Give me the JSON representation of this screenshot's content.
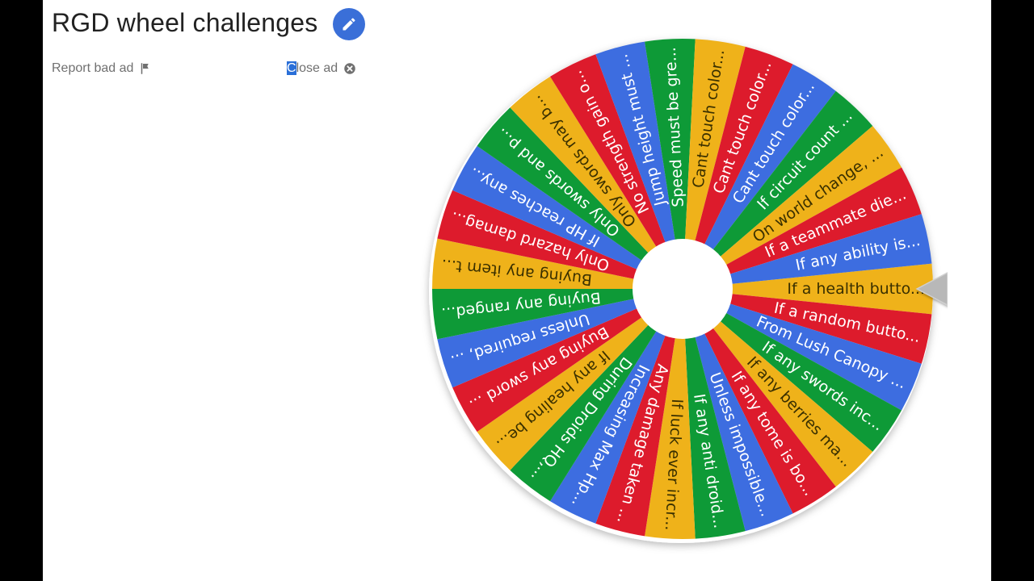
{
  "page": {
    "title": "RGD wheel challenges",
    "edit_icon": "pencil-icon",
    "report_ad_label": "Report bad ad",
    "report_icon": "flag-icon",
    "close_ad_first": "C",
    "close_ad_rest": "lose ad",
    "close_icon": "close-circle-icon"
  },
  "wheel": {
    "pointer_icon": "triangle-pointer-icon",
    "colors": [
      "#EFB21A",
      "#DD1B2C",
      "#3D6DE0",
      "#0E9A37"
    ],
    "segments": [
      "If a health butto...",
      "If a random butto...",
      "From Lush Canopy ...",
      "If any swords inc...",
      "If any berries ma...",
      "If any tome is bo...",
      "Unless impossible...",
      "If any anti droid...",
      "If luck ever incr...",
      "Any damage taken ...",
      "Increasing Max Hp...",
      "During Droids HQ,...",
      "If any healing be...",
      "Buying any sword ...",
      "Unless required, ...",
      "Buying any ranged...",
      "Buying any item t...",
      "Only hazard damag...",
      "If HP reaches any...",
      "Only swords and p...",
      "Only swords may b...",
      "No strength gain o...",
      "Jump height must ...",
      "Speed must be gre...",
      "Cant touch color...",
      "Cant touch color...",
      "Cant touch color...",
      "If circuit count ...",
      "On world change, ...",
      "If a teammate die...",
      "If any ability is..."
    ]
  }
}
